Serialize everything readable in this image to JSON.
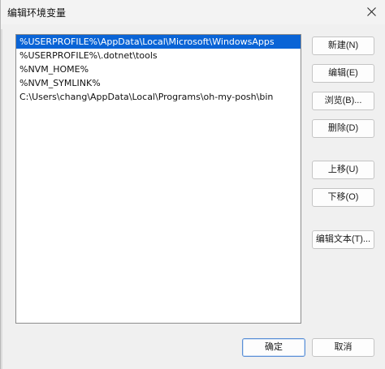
{
  "window": {
    "title": "编辑环境变量",
    "close_glyph": "×"
  },
  "paths": [
    "%USERPROFILE%\\AppData\\Local\\Microsoft\\WindowsApps",
    "%USERPROFILE%\\.dotnet\\tools",
    "%NVM_HOME%",
    "%NVM_SYMLINK%",
    "C:\\Users\\chang\\AppData\\Local\\Programs\\oh-my-posh\\bin"
  ],
  "selected_index": 0,
  "buttons": {
    "new": "新建(N)",
    "edit": "编辑(E)",
    "browse": "浏览(B)...",
    "delete": "删除(D)",
    "move_up": "上移(U)",
    "move_down": "下移(O)",
    "edit_text": "编辑文本(T)...",
    "ok": "确定",
    "cancel": "取消"
  },
  "colors": {
    "selection": "#0a64d6",
    "background": "#f0f0f0"
  }
}
